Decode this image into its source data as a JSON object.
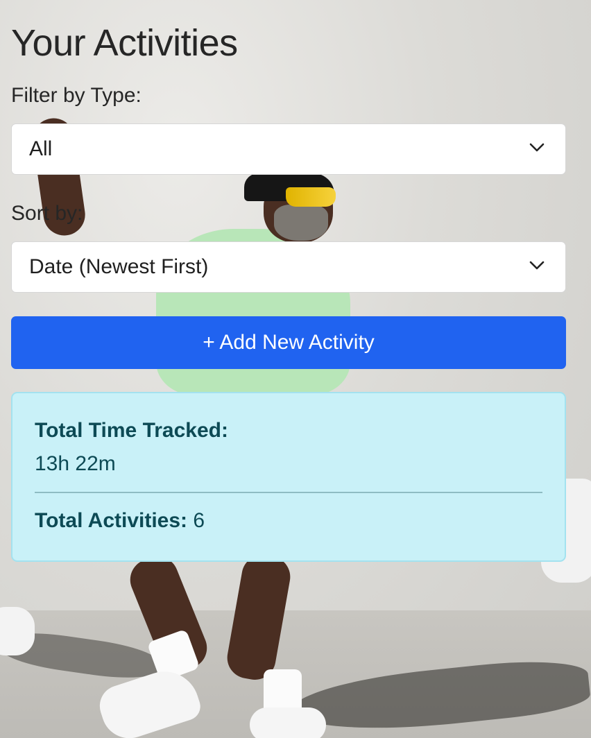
{
  "page": {
    "title": "Your Activities"
  },
  "filter": {
    "label": "Filter by Type:",
    "selected": "All",
    "icon": "chevron-down-icon"
  },
  "sort": {
    "label": "Sort by:",
    "selected": "Date (Newest First)",
    "icon": "chevron-down-icon"
  },
  "actions": {
    "add_label": "+ Add New Activity",
    "add_color": "#2063f0"
  },
  "summary": {
    "time_label": "Total Time Tracked:",
    "time_value": "13h 22m",
    "activities_label": "Total Activities:",
    "activities_value": "6",
    "bg_color": "#c9f1f8",
    "text_color": "#0d4a55"
  }
}
